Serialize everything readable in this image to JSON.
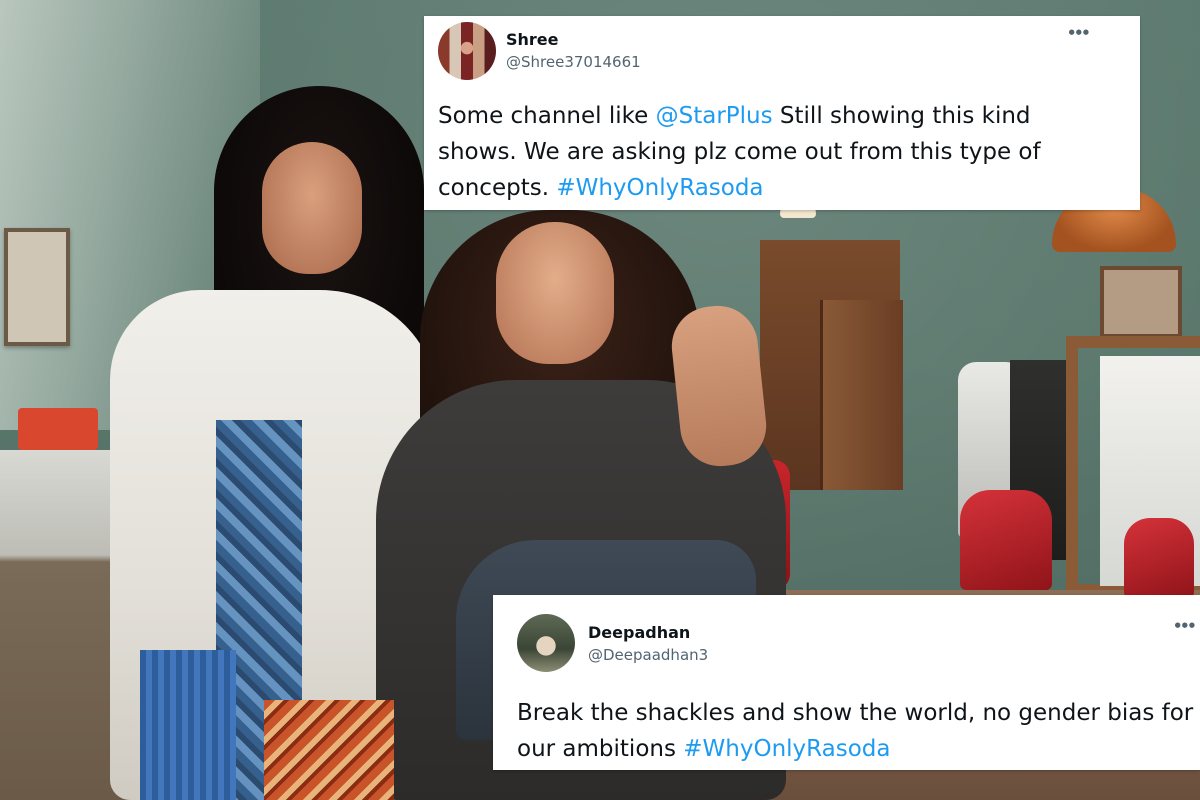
{
  "tweets": [
    {
      "name": "Shree",
      "handle": "@Shree37014661",
      "more_icon": "more-icon",
      "text": {
        "part1": "Some channel like ",
        "mention": "@StarPlus",
        "part2": " Still showing this kind shows. We are asking plz come out from this type of concepts. ",
        "hashtag": "#WhyOnlyRasoda"
      }
    },
    {
      "name": "Deepadhan",
      "handle": "@Deepaadhan3",
      "more_icon": "more-icon",
      "text": {
        "part1": "Break the shackles and show the world, no gender bias for our ambitions ",
        "hashtag": "#WhyOnlyRasoda"
      }
    }
  ],
  "colors": {
    "link": "#1d9bf0",
    "text": "#0f1419",
    "handle": "#536471"
  }
}
